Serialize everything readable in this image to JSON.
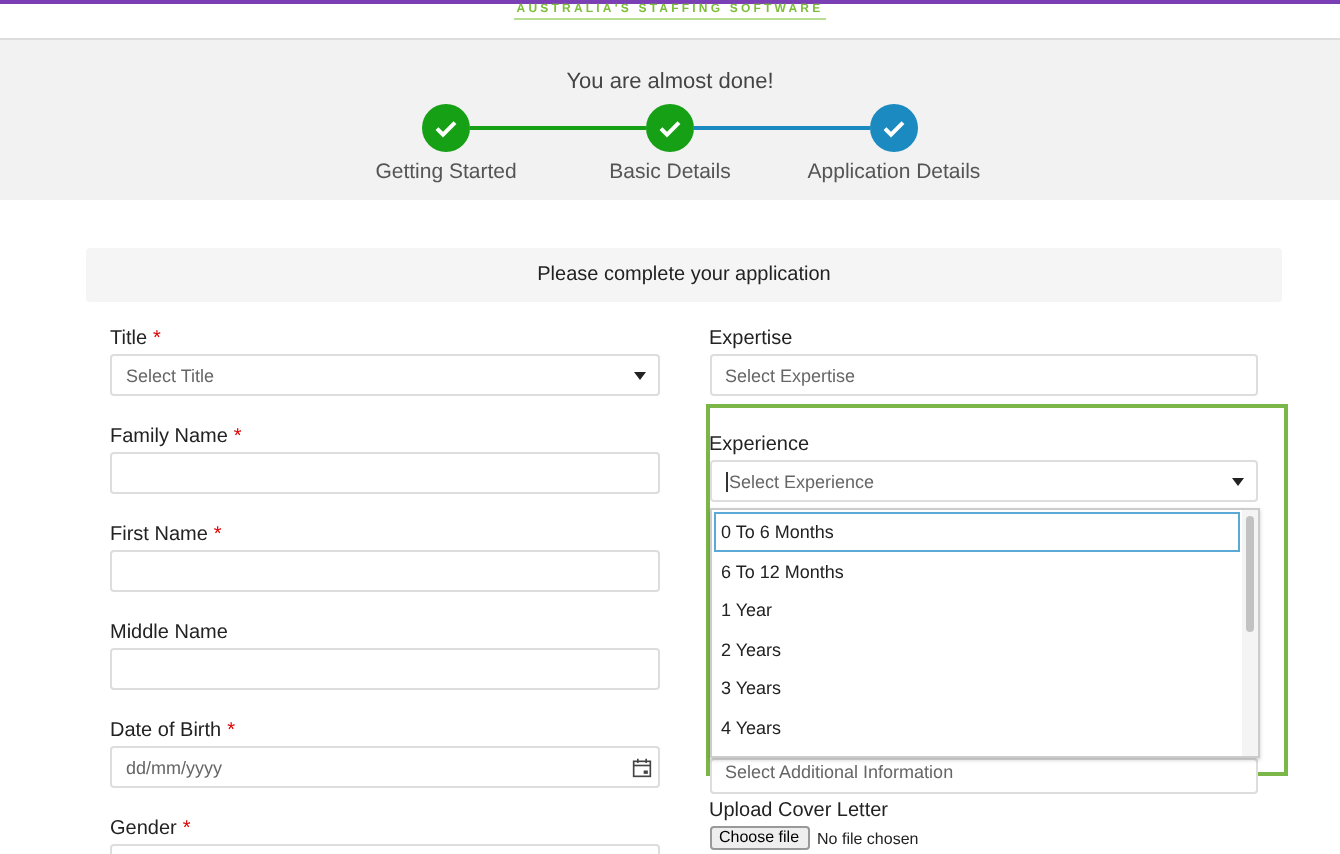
{
  "header": {
    "tagline": "AUSTRALIA'S STAFFING SOFTWARE"
  },
  "progress": {
    "title": "You are almost done!",
    "steps": [
      {
        "label": "Getting Started",
        "selected": false
      },
      {
        "label": "Basic Details",
        "selected": false
      },
      {
        "label": "Application Details",
        "selected": true
      }
    ]
  },
  "form": {
    "heading": "Please complete your application",
    "left_fields": [
      {
        "label": "Title",
        "required_mark": "*",
        "kind": "select",
        "placeholder": "Select Title"
      },
      {
        "label": "Family Name",
        "required_mark": "*",
        "kind": "text"
      },
      {
        "label": "First Name",
        "required_mark": "*",
        "kind": "text"
      },
      {
        "label": "Middle Name",
        "kind": "text"
      },
      {
        "label": "Date of Birth",
        "required_mark": "*",
        "kind": "date",
        "placeholder": "dd/mm/yyyy"
      },
      {
        "label": "Gender",
        "required_mark": "*",
        "kind": "text"
      }
    ],
    "expertise": {
      "label": "Expertise",
      "placeholder": "Select Expertise"
    },
    "experience": {
      "label": "Experience",
      "placeholder": "Select Experience",
      "options": [
        {
          "label": "0 To 6 Months",
          "selected": true
        },
        {
          "label": "6 To 12 Months",
          "selected": false
        },
        {
          "label": "1 Year",
          "selected": false
        },
        {
          "label": "2 Years",
          "selected": false
        },
        {
          "label": "3 Years",
          "selected": false
        },
        {
          "label": "4 Years",
          "selected": false
        }
      ]
    },
    "additional_information": {
      "placeholder": "Select Additional Information"
    },
    "cover_letter": {
      "label": "Upload Cover Letter",
      "button": "Choose file",
      "status": "No file chosen"
    }
  }
}
